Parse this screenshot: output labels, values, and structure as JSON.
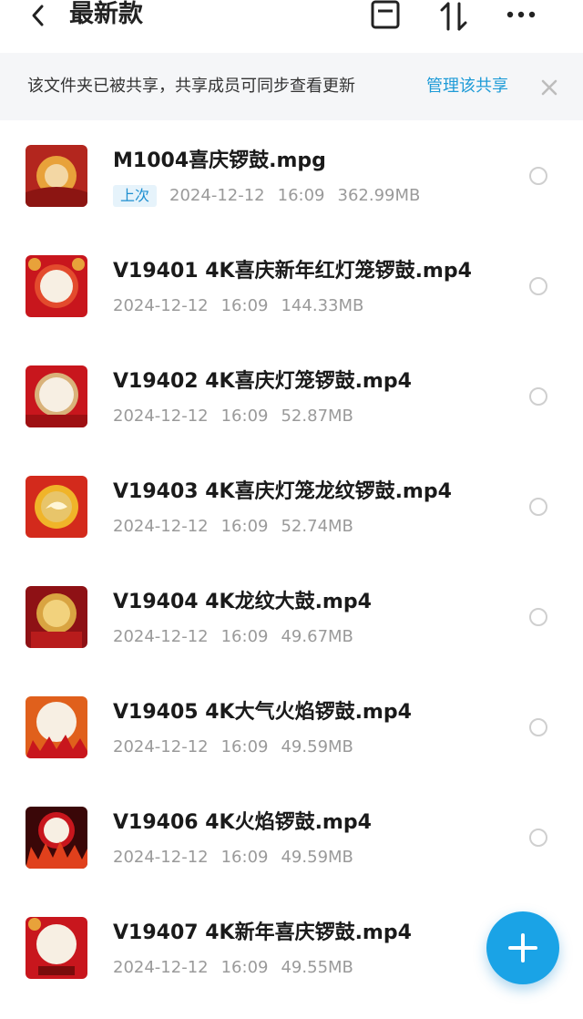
{
  "header": {
    "title": "最新款",
    "icons": [
      "back-icon",
      "select-all-icon",
      "sort-icon",
      "more-icon"
    ]
  },
  "share_banner": {
    "text": "该文件夹已被共享，共享成员可同步查看更新",
    "link": "管理该共享"
  },
  "files": [
    {
      "name": "M1004喜庆锣鼓.mpg",
      "tag": "上次",
      "date": "2024-12-12",
      "time": "16:09",
      "size": "362.99MB"
    },
    {
      "name": "V19401 4K喜庆新年红灯笼锣鼓.mp4",
      "tag": "",
      "date": "2024-12-12",
      "time": "16:09",
      "size": "144.33MB"
    },
    {
      "name": "V19402 4K喜庆灯笼锣鼓.mp4",
      "tag": "",
      "date": "2024-12-12",
      "time": "16:09",
      "size": "52.87MB"
    },
    {
      "name": "V19403 4K喜庆灯笼龙纹锣鼓.mp4",
      "tag": "",
      "date": "2024-12-12",
      "time": "16:09",
      "size": "52.74MB"
    },
    {
      "name": "V19404 4K龙纹大鼓.mp4",
      "tag": "",
      "date": "2024-12-12",
      "time": "16:09",
      "size": "49.67MB"
    },
    {
      "name": "V19405 4K大气火焰锣鼓.mp4",
      "tag": "",
      "date": "2024-12-12",
      "time": "16:09",
      "size": "49.59MB"
    },
    {
      "name": "V19406 4K火焰锣鼓.mp4",
      "tag": "",
      "date": "2024-12-12",
      "time": "16:09",
      "size": "49.59MB"
    },
    {
      "name": "V19407 4K新年喜庆锣鼓.mp4",
      "tag": "",
      "date": "2024-12-12",
      "time": "16:09",
      "size": "49.55MB"
    }
  ],
  "fab": {
    "icon": "plus-icon",
    "color": "#1aa3e6"
  },
  "colors": {
    "accent": "#1e9bd7",
    "thumb_red": "#c8161d",
    "thumb_gold": "#e8a23a"
  }
}
